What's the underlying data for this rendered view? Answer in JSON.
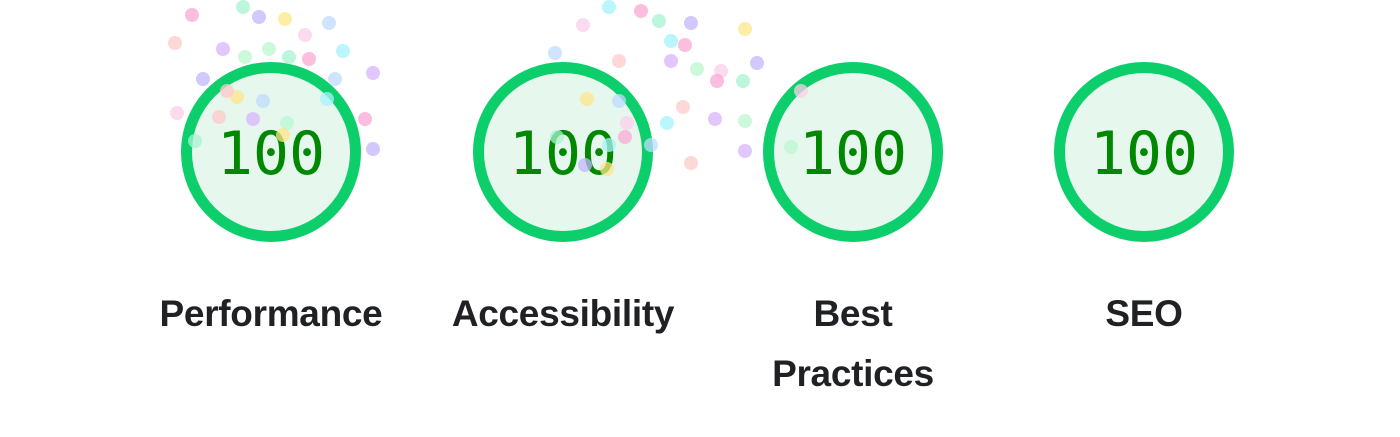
{
  "scores": [
    {
      "id": "performance",
      "value": "100",
      "label": "Performance"
    },
    {
      "id": "accessibility",
      "value": "100",
      "label": "Accessibility"
    },
    {
      "id": "best-practices",
      "value": "100",
      "label": "Best Practices"
    },
    {
      "id": "seo",
      "value": "100",
      "label": "SEO"
    }
  ],
  "colors": {
    "ring": "#0cce6b",
    "ring_fill": "#e6f8ee",
    "score_text": "#008800",
    "label_text": "#202124",
    "confetti": [
      "#f9a8d4",
      "#a7f3d0",
      "#c4b5fd",
      "#fde68a",
      "#bfdbfe",
      "#fecaca",
      "#d8b4fe",
      "#bbf7d0",
      "#fbcfe8",
      "#a5f3fc"
    ]
  }
}
